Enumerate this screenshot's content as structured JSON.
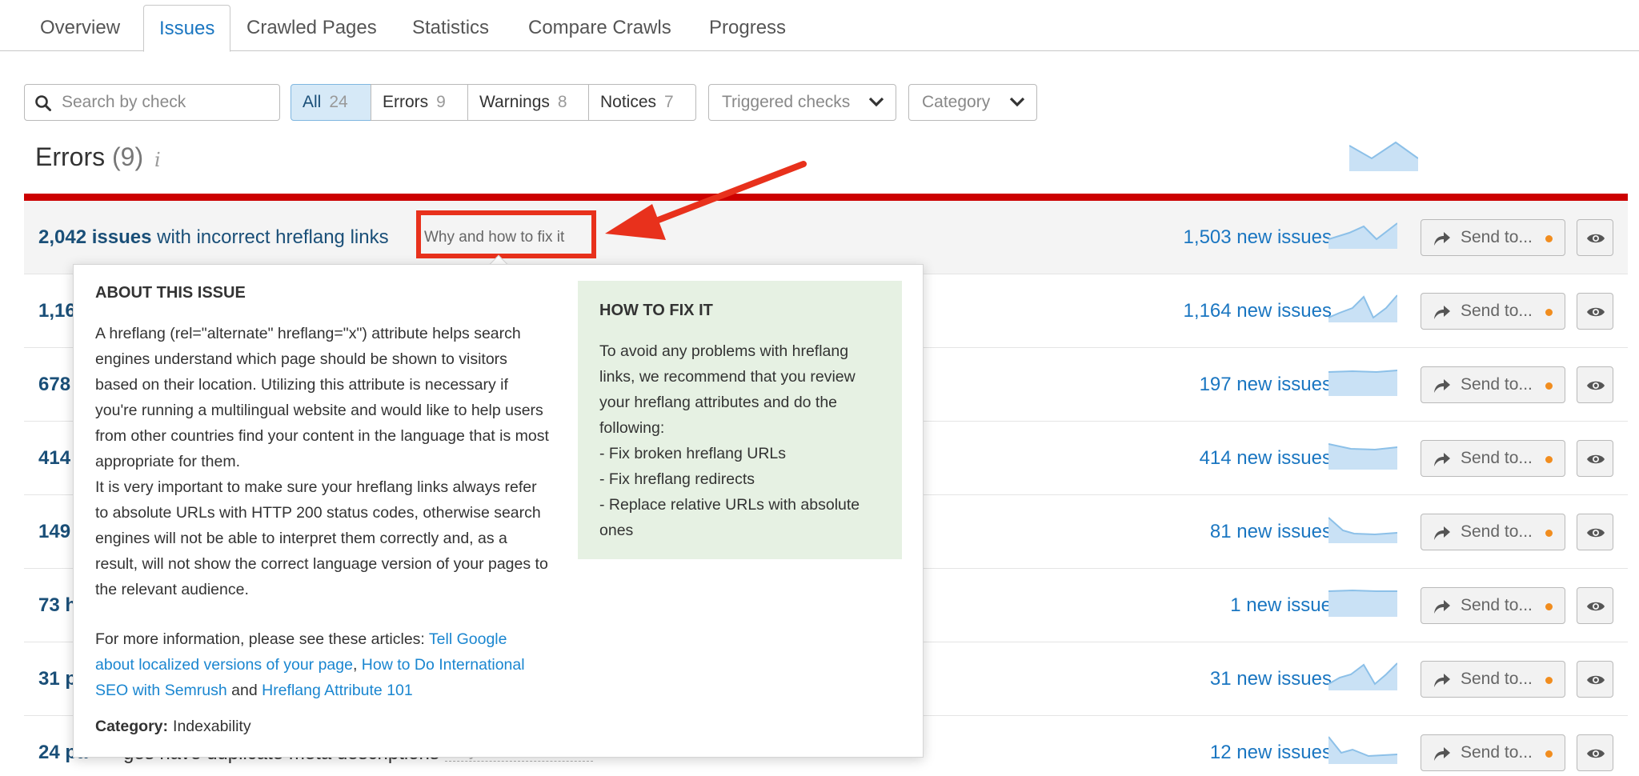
{
  "tabs": [
    {
      "label": "Overview",
      "active": false
    },
    {
      "label": "Issues",
      "active": true
    },
    {
      "label": "Crawled Pages",
      "active": false
    },
    {
      "label": "Statistics",
      "active": false
    },
    {
      "label": "Compare Crawls",
      "active": false
    },
    {
      "label": "Progress",
      "active": false
    }
  ],
  "filters": {
    "search_placeholder": "Search by check",
    "segments": [
      {
        "label": "All",
        "count": "24",
        "active": true
      },
      {
        "label": "Errors",
        "count": "9",
        "active": false
      },
      {
        "label": "Warnings",
        "count": "8",
        "active": false
      },
      {
        "label": "Notices",
        "count": "7",
        "active": false
      }
    ],
    "dropdowns": [
      {
        "label": "Triggered checks",
        "icon": "chevron-down-icon"
      },
      {
        "label": "Category",
        "icon": "chevron-down-icon"
      }
    ]
  },
  "section": {
    "title": "Errors",
    "count": "(9)",
    "info_glyph": "i",
    "accent_color": "#cc0000"
  },
  "rows": [
    {
      "count_text": "2,042 issues",
      "rest": "with incorrect hreflang links",
      "new_issues": "1,503 new issues",
      "send_label": "Send to..."
    },
    {
      "count_text": "1,16",
      "rest": "",
      "new_issues": "1,164 new issues",
      "send_label": "Send to..."
    },
    {
      "count_text": "678",
      "rest": "",
      "new_issues": "197 new issues",
      "send_label": "Send to..."
    },
    {
      "count_text": "414",
      "rest": "",
      "new_issues": "414 new issues",
      "send_label": "Send to..."
    },
    {
      "count_text": "149",
      "rest": "",
      "new_issues": "81 new issues",
      "send_label": "Send to..."
    },
    {
      "count_text": "73 h",
      "rest": "",
      "new_issues": "1 new issue",
      "send_label": "Send to..."
    },
    {
      "count_text": "31 p",
      "rest": "",
      "new_issues": "31 new issues",
      "send_label": "Send to..."
    },
    {
      "count_text": "24 pa",
      "rest": "",
      "new_issues": "12 new issues",
      "send_label": "Send to..."
    }
  ],
  "row_last_tail": "ges have duplicate meta descriptions",
  "why_link": "Why and how to fix it",
  "popup": {
    "about_heading": "ABOUT THIS ISSUE",
    "about_paragraphs": [
      "A hreflang (rel=\"alternate\" hreflang=\"x\") attribute helps search engines understand which page should be shown to visitors based on their location. Utilizing this attribute is necessary if you're running a multilingual website and would like to help users from other countries find your content in the language that is most appropriate for them.",
      "It is very important to make sure your hreflang links always refer to absolute URLs with HTTP 200 status codes, otherwise search engines will not be able to interpret them correctly and, as a result, will not show the correct language version of your pages to the relevant audience."
    ],
    "more_prefix": "For more information, please see these articles: ",
    "link1": "Tell Google about localized versions of your page",
    "sep1": ", ",
    "link2": "How to Do International SEO with Semrush",
    "sep2": " and ",
    "link3": "Hreflang Attribute 101",
    "category_label": "Category:",
    "category_value": "Indexability",
    "fix_heading": "HOW TO FIX IT",
    "fix_intro": "To avoid any problems with hreflang links, we recommend that you review your hreflang attributes and do the following:",
    "fix_items": [
      "- Fix broken hreflang URLs",
      "- Fix hreflang redirects",
      "- Replace relative URLs with absolute ones"
    ]
  },
  "colors": {
    "link_blue": "#1a76c1",
    "highlight_red": "#e8311c",
    "notification_dot": "#f18d1f",
    "fix_bg": "#e6f1e3"
  }
}
